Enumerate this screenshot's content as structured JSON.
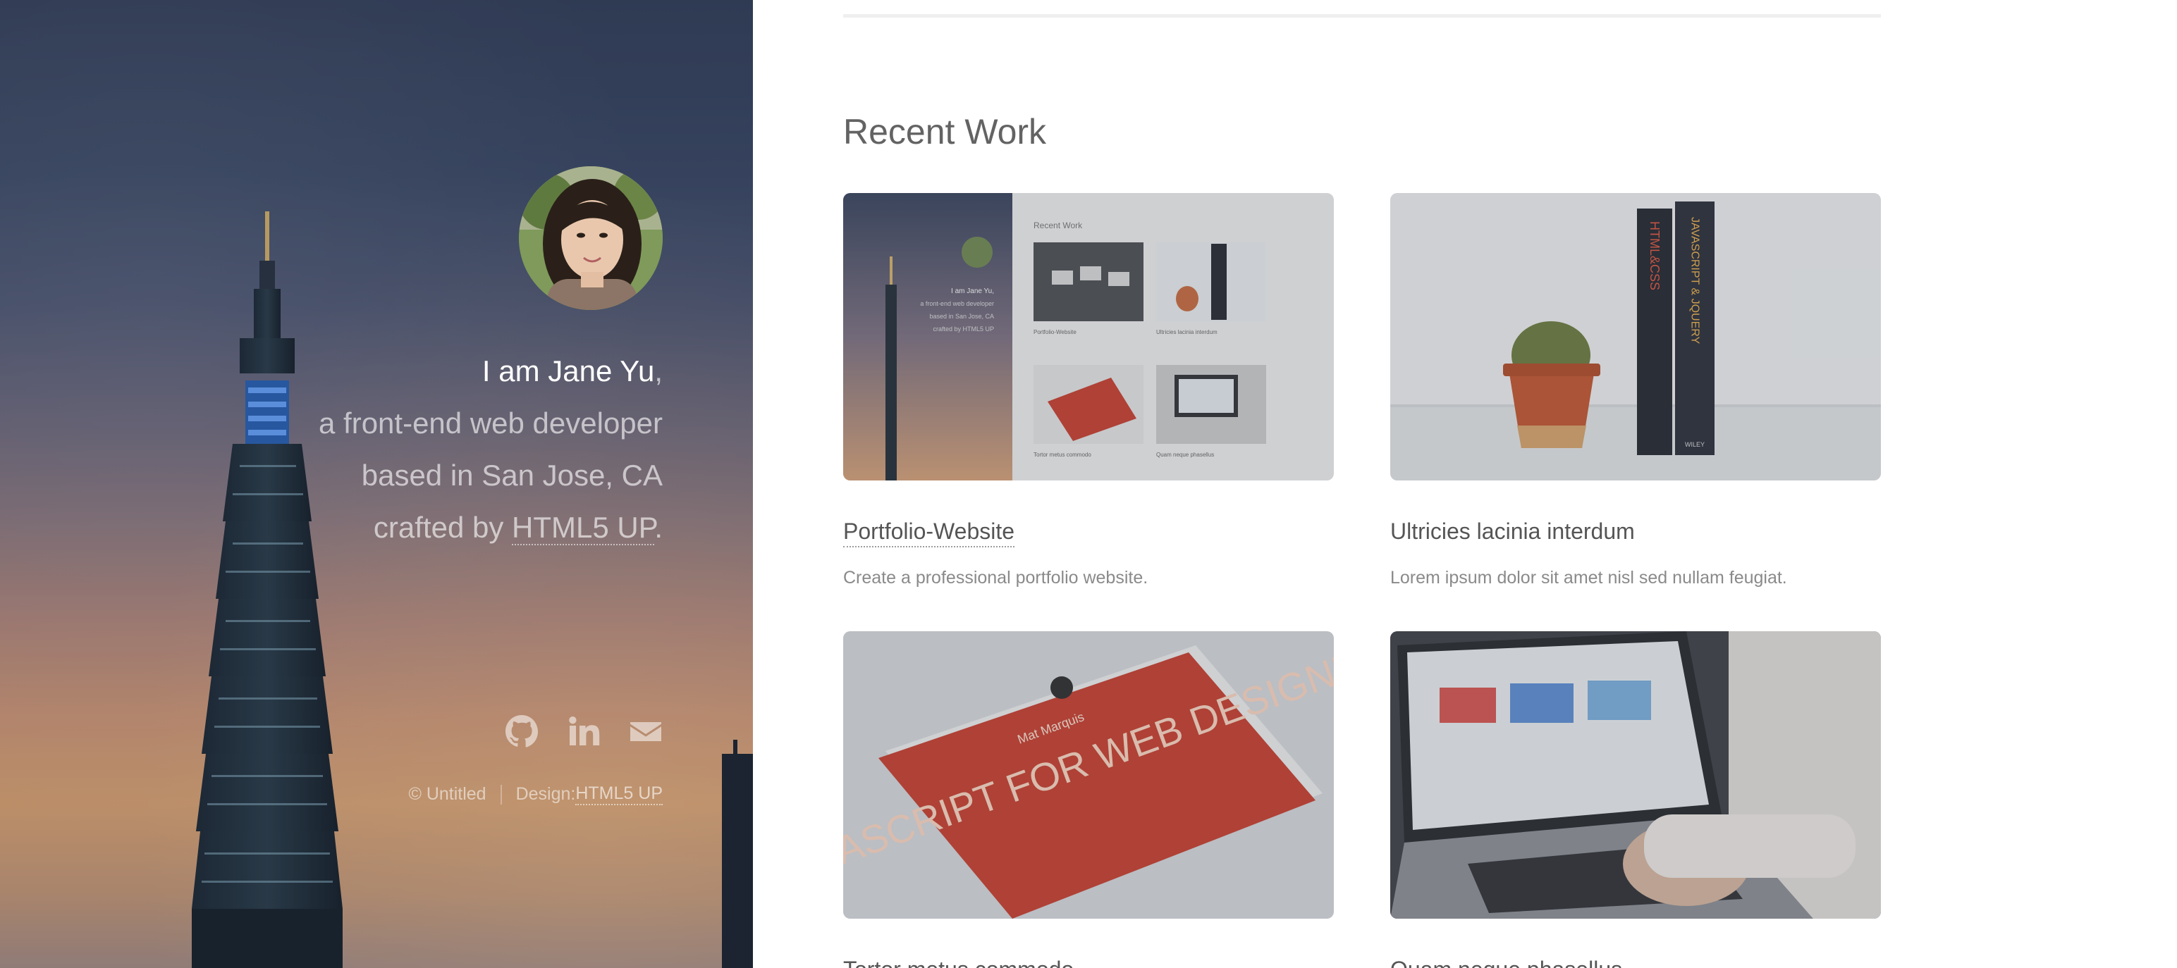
{
  "profile": {
    "name_line": "I am Jane Yu",
    "comma": ",",
    "line2": "a front-end web developer",
    "line3": "based in San Jose, CA",
    "line4_prefix": "crafted by ",
    "line4_link": "HTML5 UP",
    "line4_suffix": "."
  },
  "socials": [
    {
      "icon": "github-icon"
    },
    {
      "icon": "linkedin-icon"
    },
    {
      "icon": "envelope-icon"
    }
  ],
  "footer": {
    "copyright": "© Untitled",
    "design_label": "Design: ",
    "design_link": "HTML5 UP"
  },
  "main": {
    "section_title": "Recent Work",
    "cards": [
      {
        "title": "Portfolio-Website",
        "desc": "Create a professional portfolio website."
      },
      {
        "title": "Ultricies lacinia interdum",
        "desc": "Lorem ipsum dolor sit amet nisl sed nullam feugiat."
      },
      {
        "title": "Tortor metus commodo",
        "desc": ""
      },
      {
        "title": "Quam neque phasellus",
        "desc": ""
      }
    ]
  },
  "thumbnail": {
    "book_title": "JAVASCRIPT FOR WEB DESIGNERS",
    "book_author": "Mat Marquis",
    "spine1": "HTML&CSS",
    "spine2": "JAVASCRIPT & JQUERY",
    "spine_publisher": "WILEY",
    "mini_heading": "Recent Work",
    "mini_line1": "I am Jane Yu,",
    "mini_line2": "a front-end web developer",
    "mini_line3": "based in San Jose, CA",
    "mini_line4": "crafted by HTML5 UP",
    "mini_card1": "Portfolio-Website",
    "mini_card2": "Ultricies lacinia interdum",
    "mini_card3": "Tortor metus commodo",
    "mini_card4": "Quam neque phasellus"
  },
  "colors": {
    "sky_top": "#34405b",
    "sky_bottom": "#dfa775",
    "text_main": "#636363",
    "book_red": "#c93b2b"
  }
}
